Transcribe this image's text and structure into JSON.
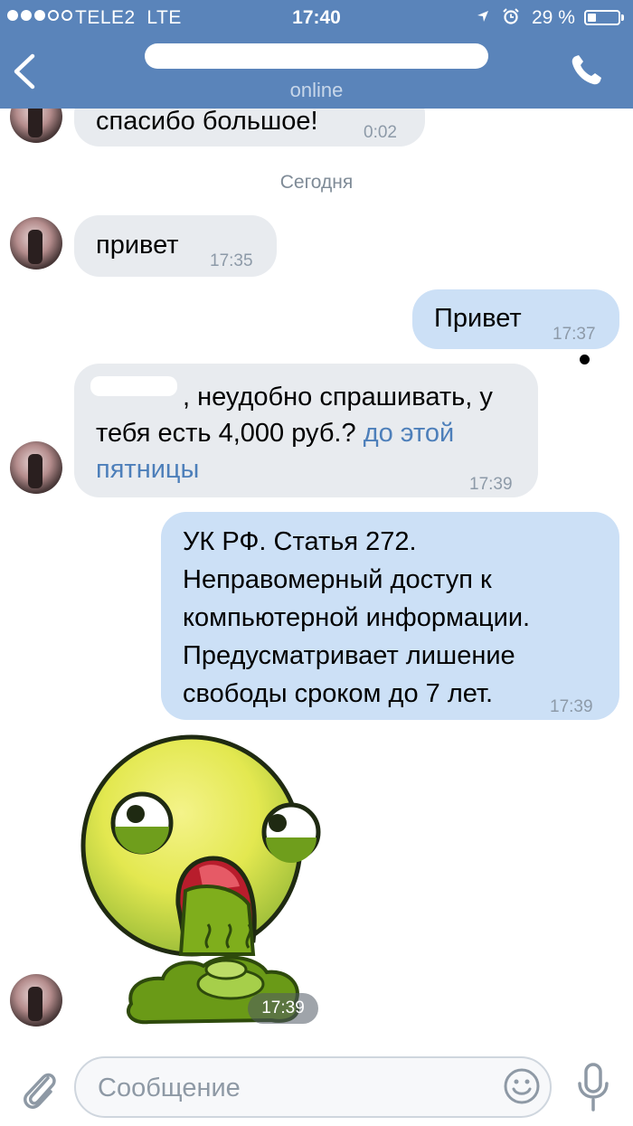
{
  "status_bar": {
    "carrier": "TELE2",
    "network": "LTE",
    "time": "17:40",
    "battery": "29 %",
    "battery_level": 0.29,
    "signal_bars": 3,
    "signal_max": 5
  },
  "header": {
    "status": "online"
  },
  "chat": {
    "date_separator": "Сегодня",
    "messages": [
      {
        "direction": "incoming",
        "text": "спасибо большое!",
        "time": "0:02"
      },
      {
        "direction": "incoming",
        "text": "привет",
        "time": "17:35"
      },
      {
        "direction": "outgoing",
        "text": "Привет",
        "time": "17:37"
      },
      {
        "direction": "incoming",
        "text": ", неудобно спрашивать, у тебя есть 4,000 руб.?",
        "link": "до этой пятницы",
        "time": "17:39"
      },
      {
        "direction": "outgoing",
        "lines": [
          "УК РФ. Статья 272.",
          "Неправомерный доступ к",
          "компьютерной информации.",
          "Предусматривает лишение",
          "свободы сроком до 7 лет."
        ],
        "time": "17:39"
      },
      {
        "direction": "incoming",
        "type": "sticker",
        "time": "17:39"
      }
    ]
  },
  "input": {
    "placeholder": "Сообщение"
  },
  "colors": {
    "header": "#5a84ba",
    "incoming_bubble": "#e8ebef",
    "outgoing_bubble": "#cce0f6",
    "link": "#4d7fba"
  },
  "icons": [
    "back-icon",
    "phone-icon",
    "location-icon",
    "alarm-icon",
    "battery-icon",
    "paperclip-icon",
    "smile-icon",
    "microphone-icon"
  ]
}
